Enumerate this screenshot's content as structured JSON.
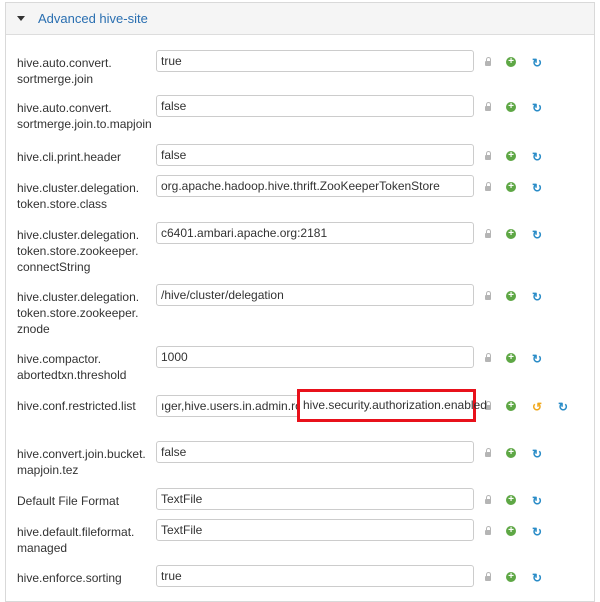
{
  "section": {
    "title": "Advanced hive-site"
  },
  "rows": [
    {
      "label_lines": [
        "hive.auto.convert.",
        "sortmerge.join"
      ],
      "value": "true"
    },
    {
      "label_lines": [
        "hive.auto.convert.",
        "sortmerge.join.to.mapjoin"
      ],
      "value": "false"
    },
    {
      "label_lines": [
        "hive.cli.print.header"
      ],
      "value": "false"
    },
    {
      "label_lines": [
        "hive.cluster.delegation.",
        "token.store.class"
      ],
      "value": "org.apache.hadoop.hive.thrift.ZooKeeperTokenStore"
    },
    {
      "label_lines": [
        "hive.cluster.delegation.",
        "token.store.zookeeper.",
        "connectString"
      ],
      "value": "c6401.ambari.apache.org:2181"
    },
    {
      "label_lines": [
        "hive.cluster.delegation.",
        "token.store.zookeeper.",
        "znode"
      ],
      "value": "/hive/cluster/delegation"
    },
    {
      "label_lines": [
        "hive.compactor.",
        "abortedtxn.threshold"
      ],
      "value": "1000"
    },
    {
      "label_lines": [
        "hive.conf.restricted.list"
      ],
      "value": "ıger,hive.users.in.admin.role",
      "highlighted_value": "hive.security.authorization.enabled"
    },
    {
      "label_lines": [
        "hive.convert.join.bucket.",
        "mapjoin.tez"
      ],
      "value": "false"
    },
    {
      "label_lines": [
        "Default File Format"
      ],
      "value": "TextFile"
    },
    {
      "label_lines": [
        "hive.default.fileformat.",
        "managed"
      ],
      "value": "TextFile"
    },
    {
      "label_lines": [
        "hive.enforce.sorting"
      ],
      "value": "true"
    }
  ],
  "icons": {
    "lock": "lock-icon",
    "add": "plus-circle-icon",
    "undo": "undo-icon",
    "refresh": "refresh-icon"
  },
  "colors": {
    "link": "#2a6fb1",
    "add": "#5ea745",
    "refresh": "#2a8cc7",
    "undo": "#f0a81c",
    "highlight": "#e8111b"
  }
}
